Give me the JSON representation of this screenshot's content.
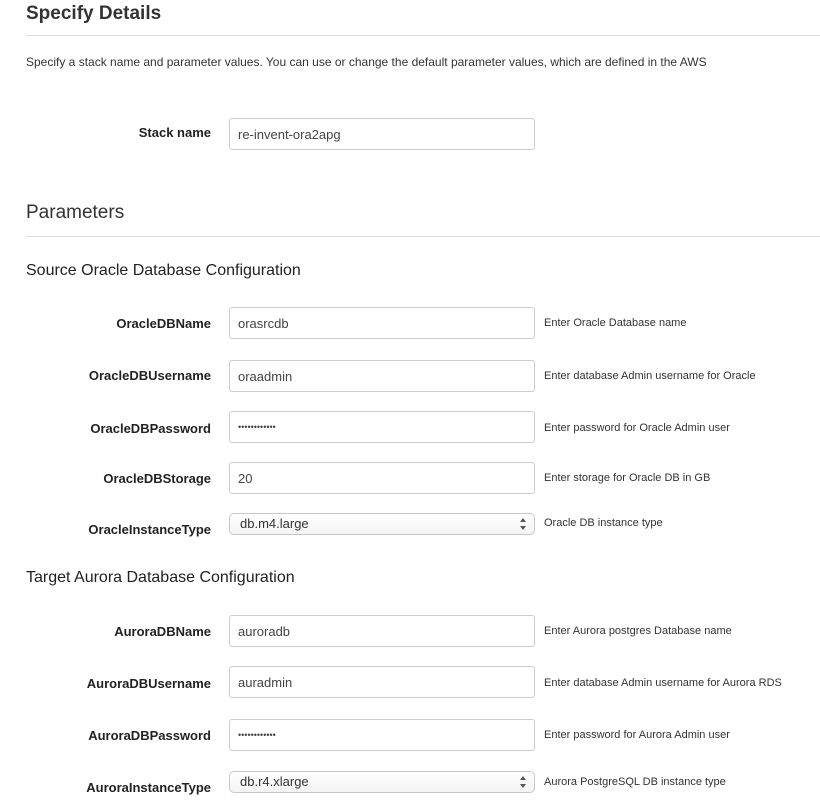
{
  "header": {
    "title": "Specify Details",
    "description": "Specify a stack name and parameter values. You can use or change the default parameter values, which are defined in the AWS"
  },
  "stack": {
    "label": "Stack name",
    "value": "re-invent-ora2apg"
  },
  "parameters": {
    "title": "Parameters",
    "source": {
      "title": "Source Oracle Database Configuration",
      "fields": [
        {
          "label": "OracleDBName",
          "value": "orasrcdb",
          "hint": "Enter Oracle Database name"
        },
        {
          "label": "OracleDBUsername",
          "value": "oraadmin",
          "hint": "Enter database Admin username for Oracle"
        },
        {
          "label": "OracleDBPassword",
          "value": "••••••••••••",
          "hint": "Enter password for Oracle Admin user"
        },
        {
          "label": "OracleDBStorage",
          "value": "20",
          "hint": "Enter storage for Oracle DB in GB"
        },
        {
          "label": "OracleInstanceType",
          "value": "db.m4.large",
          "hint": "Oracle DB instance type"
        }
      ]
    },
    "target": {
      "title": "Target Aurora Database Configuration",
      "fields": [
        {
          "label": "AuroraDBName",
          "value": "auroradb",
          "hint": "Enter Aurora postgres Database name"
        },
        {
          "label": "AuroraDBUsername",
          "value": "auradmin",
          "hint": "Enter database Admin username for Aurora RDS"
        },
        {
          "label": "AuroraDBPassword",
          "value": "••••••••••••",
          "hint": "Enter password for Aurora Admin user"
        },
        {
          "label": "AuroraInstanceType",
          "value": "db.r4.xlarge",
          "hint": "Aurora PostgreSQL DB instance type"
        }
      ]
    }
  }
}
